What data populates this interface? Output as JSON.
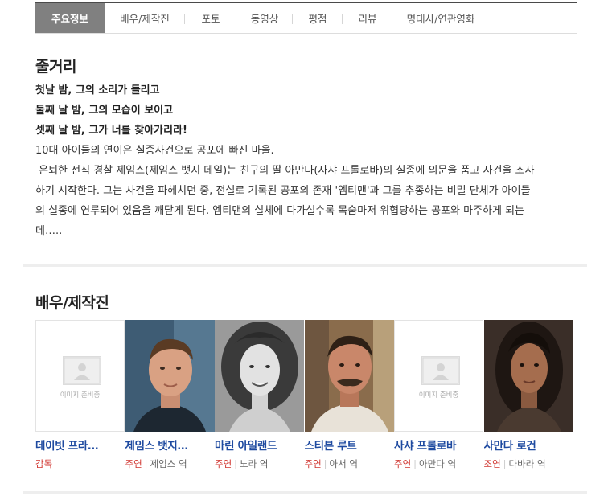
{
  "tabs": [
    {
      "label": "주요정보",
      "active": true
    },
    {
      "label": "배우/제작진",
      "active": false
    },
    {
      "label": "포토",
      "active": false
    },
    {
      "label": "동영상",
      "active": false
    },
    {
      "label": "평점",
      "active": false
    },
    {
      "label": "리뷰",
      "active": false
    },
    {
      "label": "명대사/연관영화",
      "active": false
    }
  ],
  "synopsis": {
    "title": "줄거리",
    "taglines": [
      "첫날 밤, 그의 소리가 들리고",
      "둘째 날 밤, 그의 모습이 보이고",
      "셋째 날 밤, 그가 너를 찾아가리라!"
    ],
    "body_lines": [
      "10대 아이들의 연이은 실종사건으로 공포에 빠진 마을.",
      " 은퇴한 전직 경찰 제임스(제임스 뱃지 데일)는 친구의 딸 아만다(사샤 프롤로바)의 실종에 의문을 품고 사건을 조사",
      "하기 시작한다. 그는 사건을 파헤치던 중, 전설로 기록된 공포의 존재 '엠티맨'과 그를 추종하는 비밀 단체가 아이들",
      "의 실종에 연루되어 있음을 깨닫게 된다. 엠티맨의 실체에 다가설수록 목숨마저 위협당하는 공포와 마주하게 되는",
      "데….."
    ]
  },
  "cast": {
    "title": "배우/제작진",
    "placeholder_text": "이미지 준비중",
    "people": [
      {
        "name": "데이빗 프라…",
        "role": "감독",
        "character": "",
        "photo": "placeholder"
      },
      {
        "name": "제임스 뱃지…",
        "role": "주연",
        "character": "제임스 역",
        "photo": "man-short-hair"
      },
      {
        "name": "마린 아일랜드",
        "role": "주연",
        "character": "노라 역",
        "photo": "woman-curly-bw"
      },
      {
        "name": "스티븐 루트",
        "role": "주연",
        "character": "아서 역",
        "photo": "man-mustache"
      },
      {
        "name": "사샤 프롤로바",
        "role": "주연",
        "character": "아만다 역",
        "photo": "placeholder"
      },
      {
        "name": "사만다 로건",
        "role": "조연",
        "character": "다바라 역",
        "photo": "woman-dark-hair"
      }
    ]
  }
}
